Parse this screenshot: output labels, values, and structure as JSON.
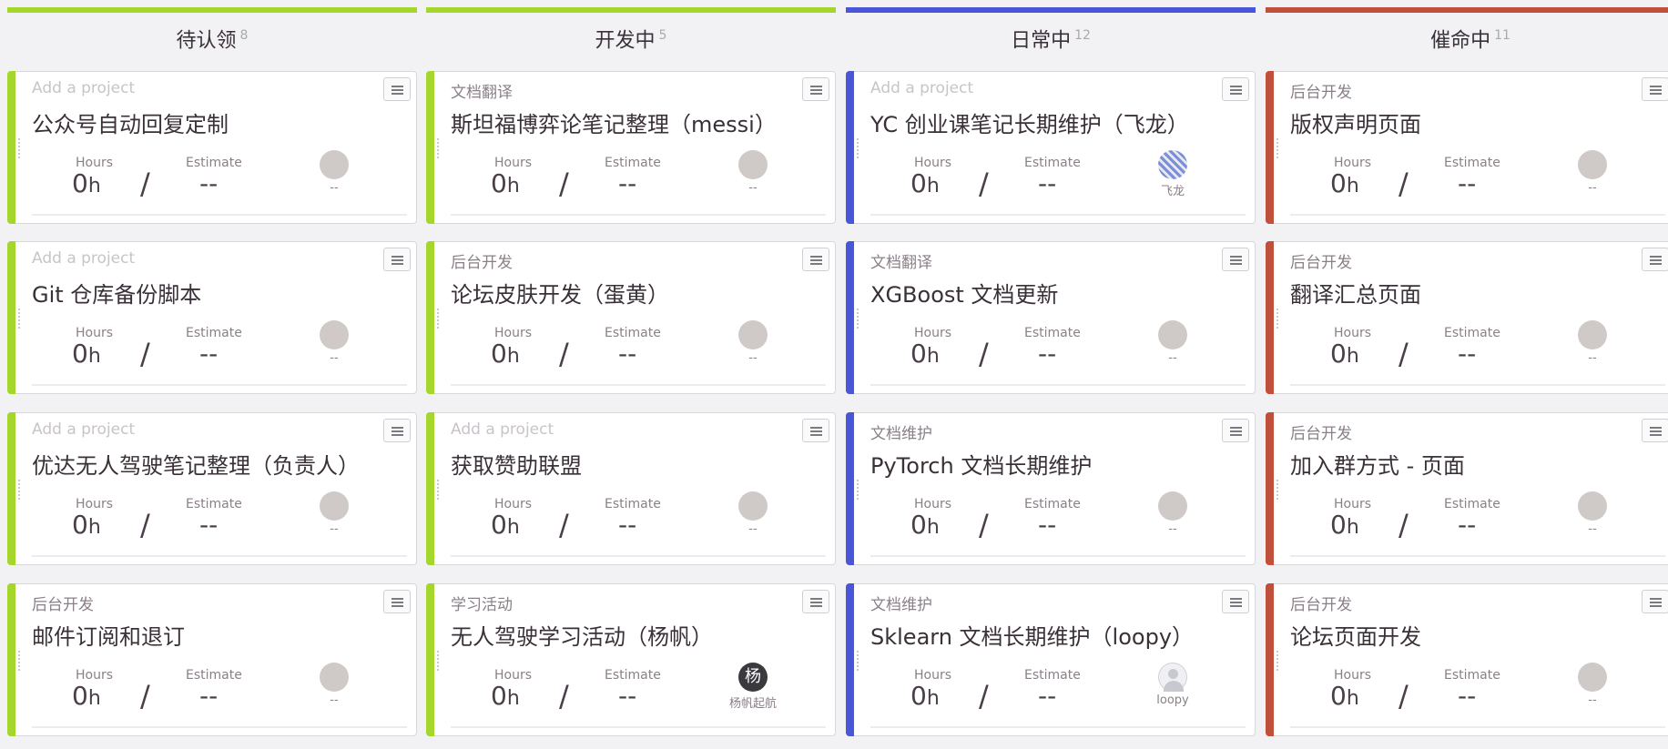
{
  "columns": [
    {
      "title": "待认领",
      "count": "8",
      "color": "#a4d62c",
      "cards": [
        {
          "tag": "Add a project",
          "tag_placeholder": true,
          "title": "公众号自动回复定制",
          "hours_label": "Hours",
          "hours": "0",
          "hours_unit": "h",
          "estimate_label": "Estimate",
          "estimate": "--",
          "assignee": "--",
          "avatar": "gray"
        },
        {
          "tag": "Add a project",
          "tag_placeholder": true,
          "title": "Git 仓库备份脚本",
          "hours_label": "Hours",
          "hours": "0",
          "hours_unit": "h",
          "estimate_label": "Estimate",
          "estimate": "--",
          "assignee": "--",
          "avatar": "gray"
        },
        {
          "tag": "Add a project",
          "tag_placeholder": true,
          "title": "优达无人驾驶笔记整理（负责人）",
          "hours_label": "Hours",
          "hours": "0",
          "hours_unit": "h",
          "estimate_label": "Estimate",
          "estimate": "--",
          "assignee": "--",
          "avatar": "gray"
        },
        {
          "tag": "后台开发",
          "tag_placeholder": false,
          "title": "邮件订阅和退订",
          "hours_label": "Hours",
          "hours": "0",
          "hours_unit": "h",
          "estimate_label": "Estimate",
          "estimate": "--",
          "assignee": "--",
          "avatar": "gray"
        }
      ]
    },
    {
      "title": "开发中",
      "count": "5",
      "color": "#a4d62c",
      "cards": [
        {
          "tag": "文档翻译",
          "tag_placeholder": false,
          "title": "斯坦福博弈论笔记整理（messi）",
          "hours_label": "Hours",
          "hours": "0",
          "hours_unit": "h",
          "estimate_label": "Estimate",
          "estimate": "--",
          "assignee": "--",
          "avatar": "gray"
        },
        {
          "tag": "后台开发",
          "tag_placeholder": false,
          "title": "论坛皮肤开发（蛋黄）",
          "hours_label": "Hours",
          "hours": "0",
          "hours_unit": "h",
          "estimate_label": "Estimate",
          "estimate": "--",
          "assignee": "--",
          "avatar": "gray"
        },
        {
          "tag": "Add a project",
          "tag_placeholder": true,
          "title": "获取赞助联盟",
          "hours_label": "Hours",
          "hours": "0",
          "hours_unit": "h",
          "estimate_label": "Estimate",
          "estimate": "--",
          "assignee": "--",
          "avatar": "gray"
        },
        {
          "tag": "学习活动",
          "tag_placeholder": false,
          "title": "无人驾驶学习活动（杨帆）",
          "hours_label": "Hours",
          "hours": "0",
          "hours_unit": "h",
          "estimate_label": "Estimate",
          "estimate": "--",
          "assignee": "杨帆起航",
          "avatar": "dark",
          "avatar_char": "杨"
        }
      ]
    },
    {
      "title": "日常中",
      "count": "12",
      "color": "#4a56d8",
      "cards": [
        {
          "tag": "Add a project",
          "tag_placeholder": true,
          "title": "YC 创业课笔记长期维护（飞龙）",
          "hours_label": "Hours",
          "hours": "0",
          "hours_unit": "h",
          "estimate_label": "Estimate",
          "estimate": "--",
          "assignee": "飞龙",
          "avatar": "tiled"
        },
        {
          "tag": "文档翻译",
          "tag_placeholder": false,
          "title": "XGBoost 文档更新",
          "hours_label": "Hours",
          "hours": "0",
          "hours_unit": "h",
          "estimate_label": "Estimate",
          "estimate": "--",
          "assignee": "--",
          "avatar": "gray"
        },
        {
          "tag": "文档维护",
          "tag_placeholder": false,
          "title": "PyTorch 文档长期维护",
          "hours_label": "Hours",
          "hours": "0",
          "hours_unit": "h",
          "estimate_label": "Estimate",
          "estimate": "--",
          "assignee": "--",
          "avatar": "gray"
        },
        {
          "tag": "文档维护",
          "tag_placeholder": false,
          "title": "Sklearn 文档长期维护（loopy）",
          "hours_label": "Hours",
          "hours": "0",
          "hours_unit": "h",
          "estimate_label": "Estimate",
          "estimate": "--",
          "assignee": "loopy",
          "avatar": "photo"
        }
      ]
    },
    {
      "title": "催命中",
      "count": "11",
      "color": "#c0503c",
      "cards": [
        {
          "tag": "后台开发",
          "tag_placeholder": false,
          "title": "版权声明页面",
          "hours_label": "Hours",
          "hours": "0",
          "hours_unit": "h",
          "estimate_label": "Estimate",
          "estimate": "--",
          "assignee": "--",
          "avatar": "gray"
        },
        {
          "tag": "后台开发",
          "tag_placeholder": false,
          "title": "翻译汇总页面",
          "hours_label": "Hours",
          "hours": "0",
          "hours_unit": "h",
          "estimate_label": "Estimate",
          "estimate": "--",
          "assignee": "--",
          "avatar": "gray"
        },
        {
          "tag": "后台开发",
          "tag_placeholder": false,
          "title": "加入群方式 - 页面",
          "hours_label": "Hours",
          "hours": "0",
          "hours_unit": "h",
          "estimate_label": "Estimate",
          "estimate": "--",
          "assignee": "--",
          "avatar": "gray"
        },
        {
          "tag": "后台开发",
          "tag_placeholder": false,
          "title": "论坛页面开发",
          "hours_label": "Hours",
          "hours": "0",
          "hours_unit": "h",
          "estimate_label": "Estimate",
          "estimate": "--",
          "assignee": "--",
          "avatar": "gray"
        }
      ]
    }
  ]
}
